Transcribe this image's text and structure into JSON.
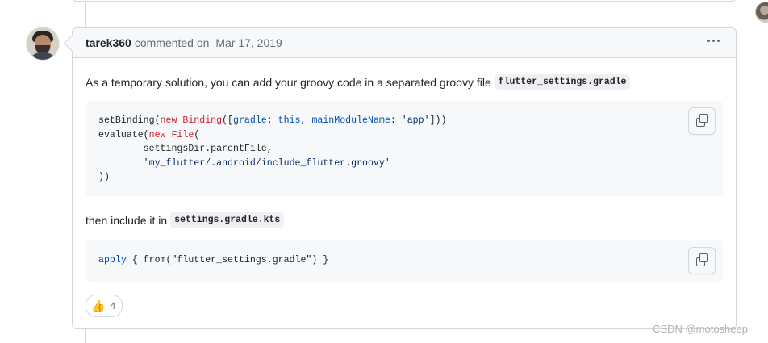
{
  "comment": {
    "author": "tarek360",
    "action": "commented on",
    "date": "Mar 17, 2019",
    "body": {
      "para1": "As a temporary solution, you can add your groovy code in a separated groovy file",
      "para1_code": "flutter_settings.gradle",
      "para2": "then include it in",
      "para2_code": "settings.gradle.kts"
    },
    "code_block_1": {
      "line1": {
        "fn": "setBinding(",
        "kw1": "new",
        "cls": "Binding",
        "open": "([",
        "key1": "gradle",
        "colon1": ": ",
        "this": "this",
        "comma": ", ",
        "key2": "mainModuleName",
        "colon2": ": ",
        "str": "'app'",
        "close": "]))"
      },
      "line2": {
        "fn": "evaluate(",
        "kw": "new",
        "cls": "File",
        "open": "("
      },
      "line3": "        settingsDir.parentFile,",
      "line4": "'my_flutter/.android/include_flutter.groovy'",
      "line4_indent": "        ",
      "line5": "))"
    },
    "code_block_2": {
      "fn": "apply",
      "rest": " { from(\"flutter_settings.gradle\") }"
    },
    "reaction": {
      "emoji": "👍",
      "count": "4"
    }
  },
  "watermark": "CSDN @motosheep",
  "icons": {
    "menu": "kebab-horizontal-icon",
    "copy": "copy-icon",
    "reaction": "thumbs-up-icon"
  },
  "colors": {
    "keyword": "#cf222e",
    "entity": "#0550ae",
    "string": "#0a3069",
    "border": "#d0d7de",
    "header_bg": "#f6f8fa"
  }
}
